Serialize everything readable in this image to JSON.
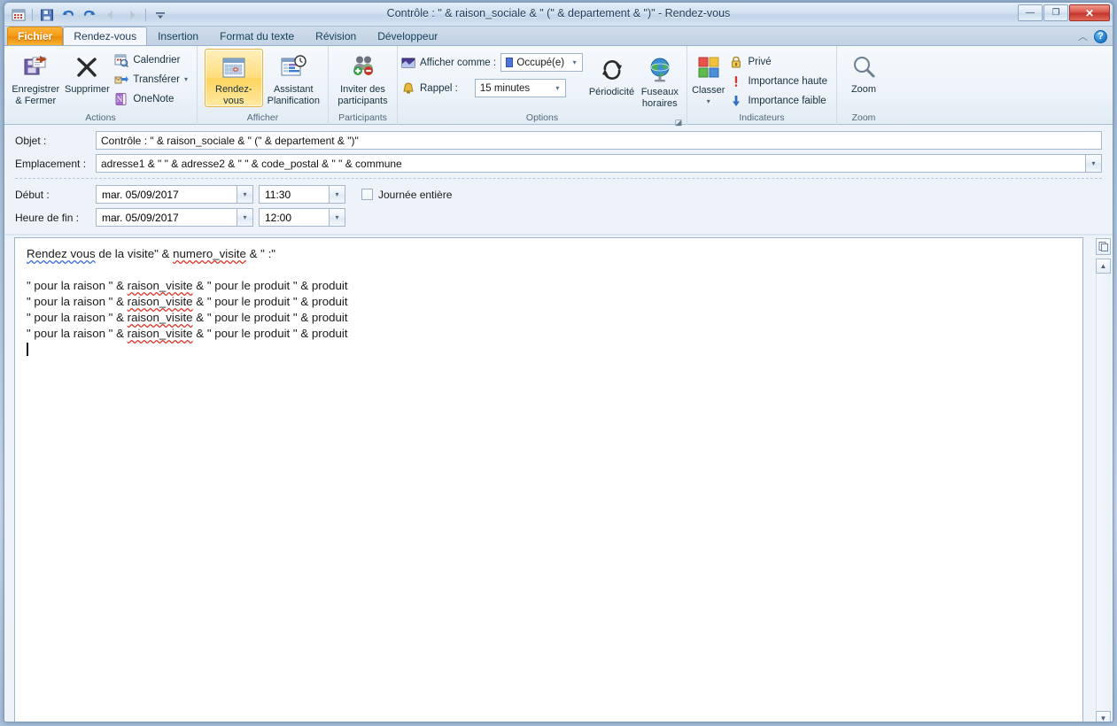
{
  "window": {
    "title": "Contrôle : \" & raison_sociale & \" (\" & departement & \")\"  -  Rendez-vous",
    "controls": {
      "minimize": "—",
      "maximize": "❐",
      "close": "✕"
    }
  },
  "quick_access": {
    "items": [
      {
        "name": "app-calendar-icon",
        "label": ""
      },
      {
        "name": "save-icon",
        "label": ""
      },
      {
        "name": "undo-icon",
        "label": ""
      },
      {
        "name": "redo-icon",
        "label": ""
      },
      {
        "name": "previous-item-icon",
        "label": ""
      },
      {
        "name": "next-item-icon",
        "label": ""
      },
      {
        "name": "customize-qat-icon",
        "label": ""
      }
    ]
  },
  "tabs": [
    {
      "label": "Fichier",
      "active": false,
      "file": true
    },
    {
      "label": "Rendez-vous",
      "active": true,
      "file": false
    },
    {
      "label": "Insertion",
      "active": false,
      "file": false
    },
    {
      "label": "Format du texte",
      "active": false,
      "file": false
    },
    {
      "label": "Révision",
      "active": false,
      "file": false
    },
    {
      "label": "Développeur",
      "active": false,
      "file": false
    }
  ],
  "tabstrip_right": {
    "collapse_ribbon": "︿",
    "help": "?"
  },
  "ribbon": {
    "groups": {
      "actions": {
        "label": "Actions",
        "save_close": "Enregistrer\n& Fermer",
        "save_close_line1": "Enregistrer",
        "save_close_line2": "& Fermer",
        "delete": "Supprimer",
        "calendar": "Calendrier",
        "forward": "Transférer",
        "onenote": "OneNote"
      },
      "afficher": {
        "label": "Afficher",
        "appointment_line1": "Rendez-vous",
        "scheduling_line1": "Assistant",
        "scheduling_line2": "Planification"
      },
      "participants": {
        "label": "Participants",
        "invite_line1": "Inviter des",
        "invite_line2": "participants"
      },
      "options": {
        "label": "Options",
        "show_as_label": "Afficher comme :",
        "show_as_value": "Occupé(e)",
        "reminder_label": "Rappel :",
        "reminder_value": "15 minutes",
        "recurrence_line1": "Périodicité",
        "timezones_line1": "Fuseaux",
        "timezones_line2": "horaires"
      },
      "indicateurs": {
        "label": "Indicateurs",
        "categorize": "Classer",
        "private": "Privé",
        "high_importance": "Importance haute",
        "low_importance": "Importance faible"
      },
      "zoom": {
        "label": "Zoom",
        "zoom_button": "Zoom"
      }
    }
  },
  "form": {
    "subject_label": "Objet :",
    "subject_value": "Contrôle : \" & raison_sociale & \" (\" & departement & \")\"",
    "location_label": "Emplacement :",
    "location_value": "adresse1 & \" \" & adresse2 & \" \" & code_postal & \" \" & commune",
    "start_label": "Début :",
    "start_date": "mar. 05/09/2017",
    "start_time": "11:30",
    "end_label": "Heure de fin :",
    "end_date": "mar. 05/09/2017",
    "end_time": "12:00",
    "all_day_label": "Journée entière",
    "all_day_checked": false
  },
  "body": {
    "line1_a": "Rendez vous",
    "line1_b": " de la visite\" & ",
    "line1_c": "numero_visite",
    "line1_d": " & \" :\"",
    "repeat_prefix": "\" pour la raison \" & ",
    "repeat_field": "raison_visite",
    "repeat_suffix": " & \" pour le produit \" & produit",
    "repeat_count": 4
  },
  "scroll": {
    "attachment_icon": "attachment-icon",
    "up_arrow": "▲",
    "down_arrow": "▼"
  },
  "colors": {
    "file_tab": "#f59a14",
    "selected_button": "#ffdd7c",
    "close_button": "#c3372c",
    "busy_swatch": "#4f73d8",
    "spell_blue": "#3f6fd8",
    "spell_red": "#d83a2e"
  }
}
